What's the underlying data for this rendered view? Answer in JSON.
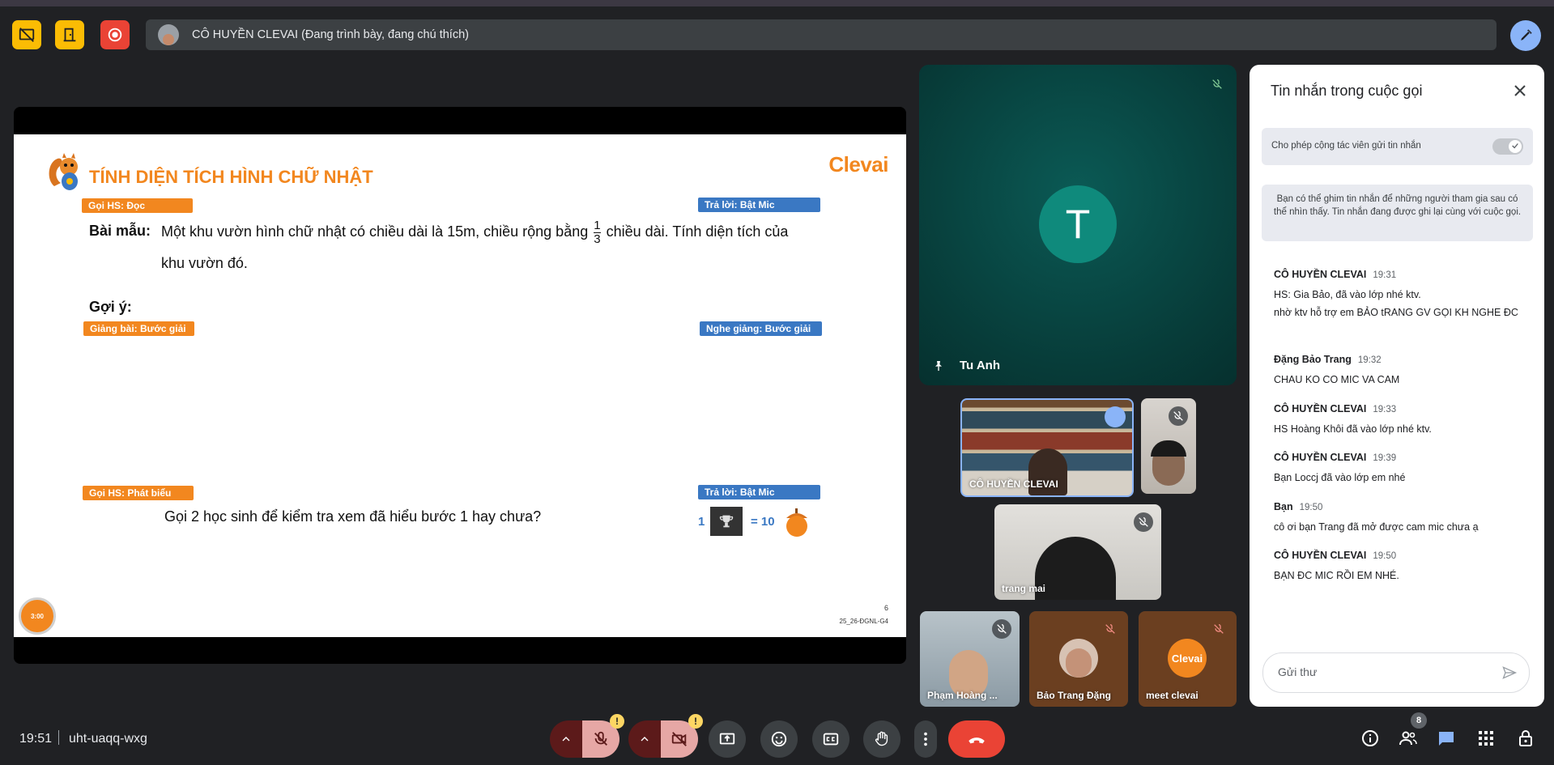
{
  "presenter_bar": {
    "text": "CÔ HUYỀN CLEVAI (Đang trình bày, đang chú thích)"
  },
  "slide": {
    "title": "TÍNH DIỆN TÍCH HÌNH CHỮ NHẬT",
    "brand": "Clevai",
    "tag_goi_doc": "Gọi HS: Đọc",
    "tag_tra_loi_1": "Trả lời: Bật Mic",
    "sample_label": "Bài mẫu:",
    "sample_text_a": "Một khu vườn hình chữ nhật có chiều dài là 15m, chiều rộng bằng",
    "frac_num": "1",
    "frac_den": "3",
    "sample_text_b": "chiều dài. Tính diện tích của",
    "sample_text_c": "khu vườn đó.",
    "hint_label": "Gợi ý:",
    "tag_giang_bai": "Giảng bài: Bước giải",
    "tag_nghe_giang": "Nghe giảng: Bước giải",
    "tag_goi_phat_bieu": "Gọi HS: Phát biểu",
    "tag_tra_loi_2": "Trả lời: Bật Mic",
    "question": "Gọi 2 học sinh để kiểm tra xem đã hiểu bước 1 hay chưa?",
    "reward_count": "1",
    "reward_equals": "= 10",
    "page_number": "6",
    "slide_code": "25_26-ĐGNL-G4",
    "timer": "3:00"
  },
  "participants": {
    "pinned": {
      "initial": "T",
      "name": "Tu Anh"
    },
    "tiles": [
      {
        "name": "CÔ HUYỀN CLEVAI"
      },
      {
        "name": "trang mai"
      },
      {
        "name": "Phạm Hoàng ..."
      },
      {
        "name": "Bảo Trang Đặng"
      },
      {
        "name": "meet clevai",
        "logo": "Clevai"
      }
    ]
  },
  "chat": {
    "title": "Tin nhắn trong cuộc gọi",
    "toggle_label": "Cho phép cộng tác viên gửi tin nhắn",
    "toggle_on": true,
    "info": "Bạn có thể ghim tin nhắn để những người tham gia sau có thể nhìn thấy. Tin nhắn đang được ghi lại cùng với cuộc gọi.",
    "messages": [
      {
        "sender": "CÔ HUYỀN CLEVAI",
        "time": "19:31",
        "lines": [
          "HS:  Gia Bảo,  đã vào lớp nhé ktv.",
          "nhờ ktv hỗ trợ em BẢO tRANG GV GỌI KH NGHE ĐC"
        ]
      },
      {
        "sender": "Đặng Bảo Trang",
        "time": "19:32",
        "lines": [
          "CHAU KO CO MIC VA CAM"
        ]
      },
      {
        "sender": "CÔ HUYỀN CLEVAI",
        "time": "19:33",
        "lines": [
          "HS Hoàng Khôi đã vào lớp nhé ktv."
        ]
      },
      {
        "sender": "CÔ HUYỀN CLEVAI",
        "time": "19:39",
        "lines": [
          "Bạn Loccj đã vào lớp em nhé"
        ]
      },
      {
        "sender": "Bạn",
        "time": "19:50",
        "lines": [
          "cô ơi bạn Trang đã mở được cam mic chưa ạ"
        ]
      },
      {
        "sender": "CÔ HUYỀN CLEVAI",
        "time": "19:50",
        "lines": [
          "BẠN ĐC MIC RỒI EM NHÉ."
        ]
      }
    ],
    "input_placeholder": "Gửi thư"
  },
  "bottom_bar": {
    "time": "19:51",
    "meeting_code": "uht-uaqq-wxg",
    "people_count": "8",
    "mic_warning": "!",
    "cam_warning": "!"
  },
  "colors": {
    "background": "#202124",
    "brand_orange": "#f2871f",
    "slide_blue_tag": "#3a78c3",
    "end_call": "#ea4335",
    "accent_blue": "#8ab4f8",
    "pinned_teal": "#0f8a7c"
  },
  "icons": [
    "screen-share-off-icon",
    "door-icon",
    "record-icon",
    "annotate-pen-icon",
    "mic-off-icon",
    "camera-off-icon",
    "present-icon",
    "emoji-icon",
    "captions-icon",
    "raise-hand-icon",
    "more-options-icon",
    "end-call-icon",
    "info-icon",
    "people-icon",
    "chat-icon",
    "activities-icon",
    "host-controls-icon",
    "pin-icon",
    "close-icon",
    "send-icon"
  ]
}
